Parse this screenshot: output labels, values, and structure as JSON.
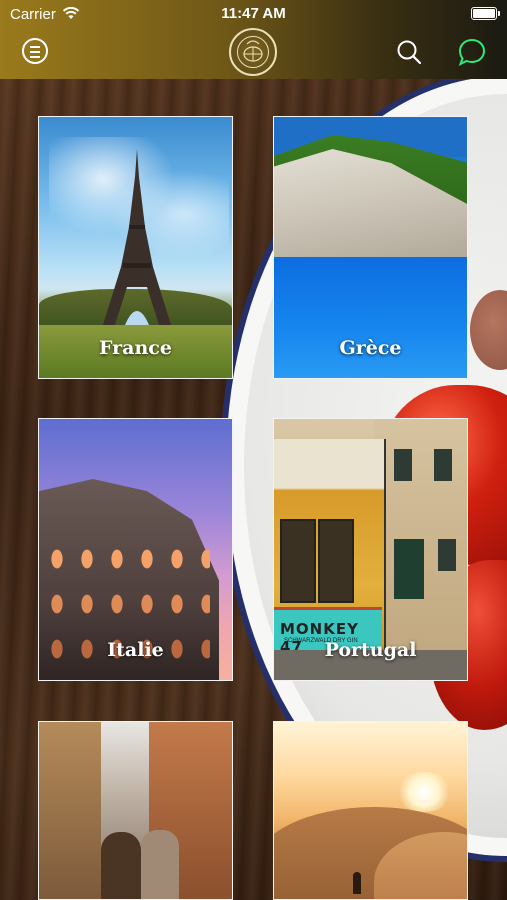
{
  "status_bar": {
    "carrier": "Carrier",
    "time": "11:47 AM"
  },
  "header": {
    "menu_icon": "hamburger-circle-icon",
    "logo_icon": "brand-logo-seal",
    "search_icon": "search-icon",
    "chat_icon": "chat-bubble-icon",
    "colors": {
      "gradient_start": "#9a7a1c",
      "gradient_end": "#1b1a12",
      "chat_icon": "#2ee87a"
    }
  },
  "destinations": [
    {
      "label": "France"
    },
    {
      "label": "Grèce"
    },
    {
      "label": "Italie"
    },
    {
      "label": "Portugal"
    },
    {
      "label": ""
    },
    {
      "label": ""
    }
  ],
  "portugal_tram": {
    "ad_text": "MONKEY 47",
    "ad_subtext": "SCHWARZWALD DRY GIN"
  }
}
